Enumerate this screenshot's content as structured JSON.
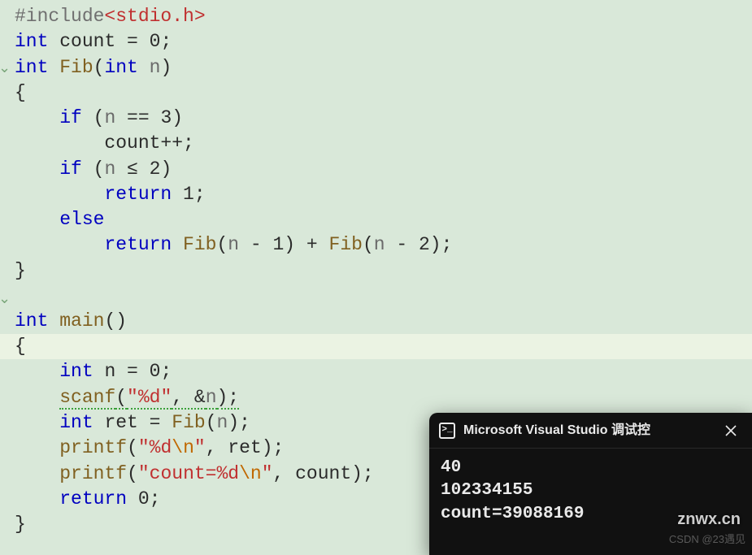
{
  "code": {
    "l1_inc": "#include",
    "l1_hdr": "<stdio.h>",
    "l2_type": "int",
    "l2_rest": " count = 0;",
    "l3_type": "int",
    "l3_fn": " Fib",
    "l3_p1": "(",
    "l3_ptype": "int",
    "l3_pname": " n",
    "l3_p2": ")",
    "l4": "{",
    "l5_kw": "if",
    "l5_cond": " (",
    "l5_pn": "n",
    "l5_rest": " == 3)",
    "l6": "        count++;",
    "l7_kw": "if",
    "l7_cond": " (",
    "l7_pn": "n",
    "l7_rest": " ≤ 2)",
    "l8_kw": "return",
    "l8_rest": " 1;",
    "l9_kw": "else",
    "l10_kw": "return",
    "l10_fn1": " Fib",
    "l10_p1": "(",
    "l10_pn1": "n",
    "l10_mid": " - 1) + ",
    "l10_fn2": "Fib",
    "l10_p2": "(",
    "l10_pn2": "n",
    "l10_end": " - 2);",
    "l11": "}",
    "l12_type": "int",
    "l12_fn": " main",
    "l12_par": "()",
    "l13": "{",
    "l14_type": "int",
    "l14_rest": " n = 0;",
    "l15_fn": "scanf",
    "l15_p1": "(",
    "l15_str": "\"%d\"",
    "l15_mid": ", &",
    "l15_pn": "n",
    "l15_end": ");",
    "l16_type": "int",
    "l16_mid": " ret = ",
    "l16_fn": "Fib",
    "l16_p1": "(",
    "l16_pn": "n",
    "l16_end": ");",
    "l17_fn": "printf",
    "l17_p1": "(",
    "l17_str1": "\"%d",
    "l17_esc": "\\n",
    "l17_str2": "\"",
    "l17_end": ", ret);",
    "l18_fn": "printf",
    "l18_p1": "(",
    "l18_str1": "\"count=%d",
    "l18_esc": "\\n",
    "l18_str2": "\"",
    "l18_end": ", count);",
    "l19_kw": "return",
    "l19_rest": " 0;",
    "l20": "}"
  },
  "console": {
    "title": "Microsoft Visual Studio 调试控",
    "out1": "40",
    "out2": "102334155",
    "out3": "count=39088169"
  },
  "watermark1": "znwx.cn",
  "watermark2": "CSDN @23遇见"
}
